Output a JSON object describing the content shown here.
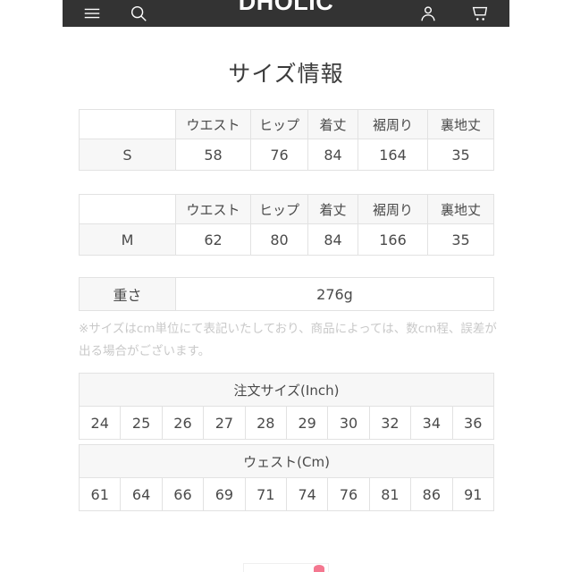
{
  "header": {
    "brand": "DHOLIC",
    "icons": {
      "menu": "hamburger-menu-icon",
      "search": "search-icon",
      "account": "account-icon",
      "cart": "shopping-cart-icon"
    },
    "background_color": "#333333"
  },
  "page_title": "サイズ情報",
  "size_tables": [
    {
      "columns": [
        "",
        "ウエスト",
        "ヒップ",
        "着丈",
        "裾周り",
        "裏地丈"
      ],
      "size_label": "S",
      "values": [
        "58",
        "76",
        "84",
        "164",
        "35"
      ]
    },
    {
      "columns": [
        "",
        "ウエスト",
        "ヒップ",
        "着丈",
        "裾周り",
        "裏地丈"
      ],
      "size_label": "M",
      "values": [
        "62",
        "80",
        "84",
        "166",
        "35"
      ]
    }
  ],
  "weight": {
    "label": "重さ",
    "value": "276g"
  },
  "note": "※サイズはcm単位にて表記いたしており、商品によっては、数cm程、誤差が出る場合がございます。",
  "conversion": {
    "inch": {
      "title": "注文サイズ(Inch)",
      "values": [
        "24",
        "25",
        "26",
        "27",
        "28",
        "29",
        "30",
        "32",
        "34",
        "36"
      ]
    },
    "cm": {
      "title": "ウェスト(Cm)",
      "values": [
        "61",
        "64",
        "66",
        "69",
        "71",
        "74",
        "76",
        "81",
        "86",
        "91"
      ]
    }
  },
  "colors": {
    "header_bg": "#333333",
    "table_header_bg": "#f7f7f7",
    "border": "#e2e2e2",
    "text": "#4a4a4a",
    "note_text": "#c9c9c9",
    "accent": "#f2607d"
  }
}
